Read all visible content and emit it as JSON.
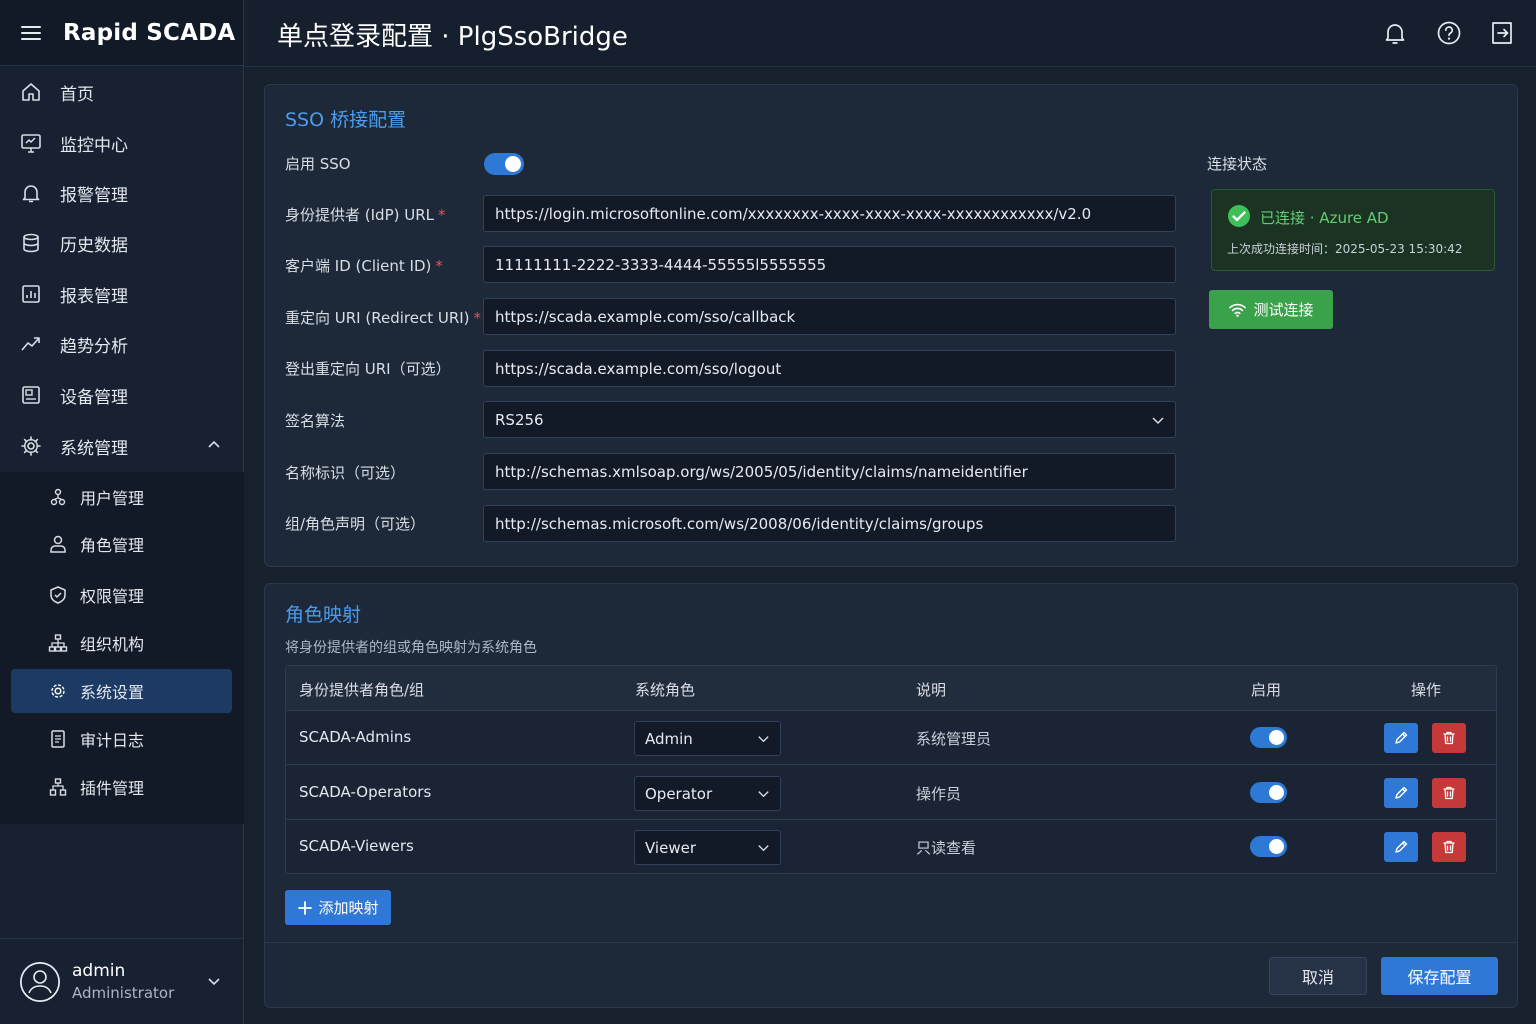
{
  "app": {
    "brand": "Rapid SCADA",
    "page_title": "单点登录配置 · PlgSsoBridge"
  },
  "sidebar": {
    "items": [
      {
        "label": "首页",
        "icon": "home-icon"
      },
      {
        "label": "监控中心",
        "icon": "monitor-icon"
      },
      {
        "label": "报警管理",
        "icon": "bell-icon"
      },
      {
        "label": "历史数据",
        "icon": "database-icon"
      },
      {
        "label": "报表管理",
        "icon": "report-icon"
      },
      {
        "label": "趋势分析",
        "icon": "trend-icon"
      },
      {
        "label": "设备管理",
        "icon": "device-icon"
      },
      {
        "label": "系统管理",
        "icon": "gear-icon",
        "expanded": true
      }
    ],
    "subitems": [
      {
        "label": "用户管理",
        "icon": "users-icon"
      },
      {
        "label": "角色管理",
        "icon": "role-icon"
      },
      {
        "label": "权限管理",
        "icon": "shield-icon"
      },
      {
        "label": "组织机构",
        "icon": "org-icon"
      },
      {
        "label": "系统设置",
        "icon": "settings-icon",
        "active": true
      },
      {
        "label": "审计日志",
        "icon": "log-icon"
      },
      {
        "label": "插件管理",
        "icon": "plugin-icon"
      }
    ],
    "user": {
      "name": "admin",
      "role": "Administrator"
    }
  },
  "sso": {
    "title": "SSO 桥接配置",
    "enable_label": "启用 SSO",
    "enabled": true,
    "fields": {
      "idp_url": {
        "label": "身份提供者 (IdP) URL",
        "value": "https://login.microsoftonline.com/xxxxxxxx-xxxx-xxxx-xxxx-xxxxxxxxxxxx/v2.0"
      },
      "client_id": {
        "label": "客户端 ID (Client ID)",
        "value": "11111111-2222-3333-4444-55555l5555555"
      },
      "redirect_uri": {
        "label": "重定向 URI (Redirect URI)",
        "value": "https://scada.example.com/sso/callback"
      },
      "logout_uri": {
        "label": "登出重定向 URI（可选）",
        "value": "https://scada.example.com/sso/logout"
      },
      "sign_alg": {
        "label": "签名算法",
        "value": "RS256"
      },
      "name_id": {
        "label": "名称标识（可选）",
        "value": "http://schemas.xmlsoap.org/ws/2005/05/identity/claims/nameidentifier"
      },
      "group_claim": {
        "label": "组/角色声明（可选）",
        "value": "http://schemas.microsoft.com/ws/2008/06/identity/claims/groups"
      }
    },
    "required_mark": "*",
    "status": {
      "label": "连接状态",
      "text": "已连接 · Azure AD",
      "last_time": "上次成功连接时间：2025-05-23 15:30:42",
      "color": "#62cf74"
    },
    "test_button": "测试连接"
  },
  "mapping": {
    "title": "角色映射",
    "description": "将身份提供者的组或角色映射为系统角色",
    "headers": [
      "身份提供者角色/组",
      "系统角色",
      "说明",
      "启用",
      "操作"
    ],
    "rows": [
      {
        "group": "SCADA-Admins",
        "role": "Admin",
        "desc": "系统管理员",
        "enabled": true
      },
      {
        "group": "SCADA-Operators",
        "role": "Operator",
        "desc": "操作员",
        "enabled": true
      },
      {
        "group": "SCADA-Viewers",
        "role": "Viewer",
        "desc": "只读查看",
        "enabled": true
      }
    ],
    "add_button": "添加映射"
  },
  "footer": {
    "cancel": "取消",
    "save": "保存配置"
  },
  "colors": {
    "accent": "#2f78d6",
    "danger": "#c63939",
    "success": "#3aa24b",
    "title_blue": "#4a9df0"
  }
}
